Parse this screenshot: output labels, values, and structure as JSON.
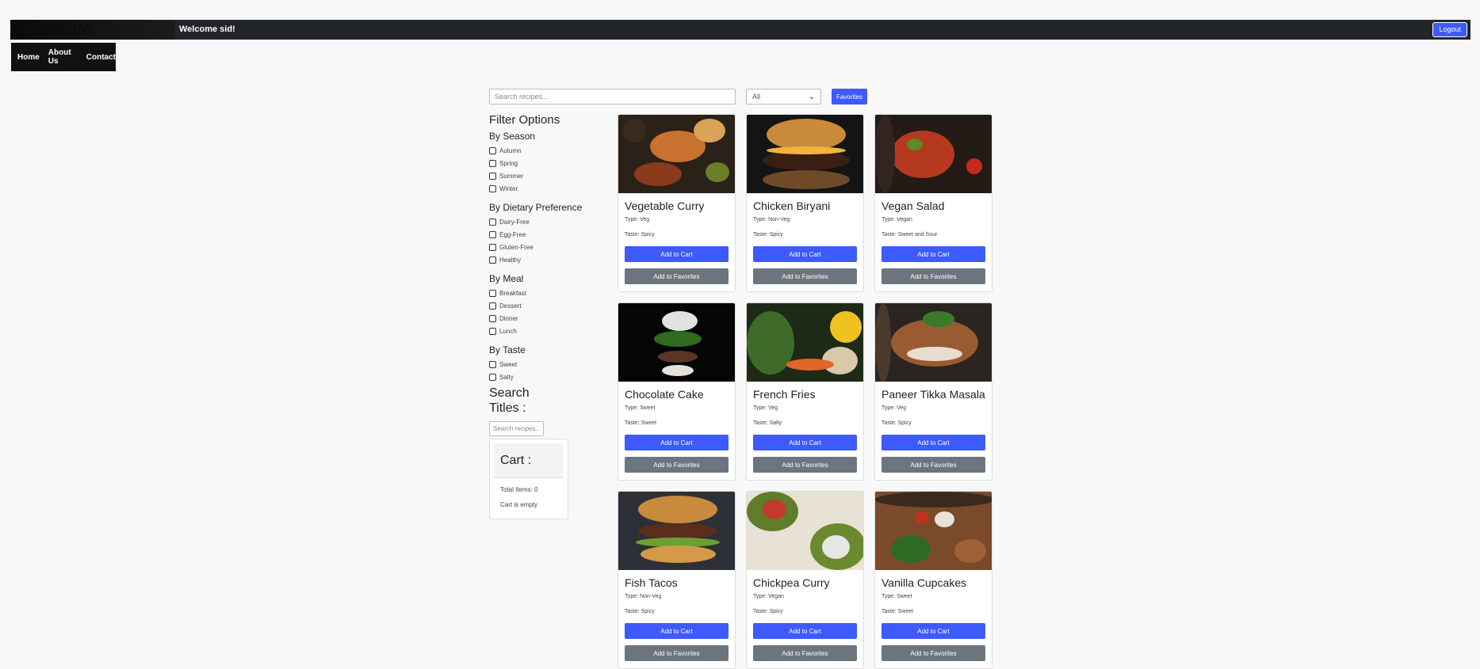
{
  "header": {
    "brand": "OneAssure",
    "welcome": "Welcome sid!",
    "logout_label": "Logout"
  },
  "nav": {
    "home": "Home",
    "about": "About Us",
    "contact": "Contact"
  },
  "search": {
    "placeholder": "Search recipes...",
    "filter_select": "All",
    "favorites_label": "Favorites"
  },
  "sidebar": {
    "title": "Filter Options",
    "groups": [
      {
        "title": "By Season",
        "options": [
          "Autumn",
          "Spring",
          "Summer",
          "Winter"
        ]
      },
      {
        "title": "By Dietary Preference",
        "options": [
          "Dairy-Free",
          "Egg-Free",
          "Gluten-Free",
          "Healthy"
        ]
      },
      {
        "title": "By Meal",
        "options": [
          "Breakfast",
          "Dessert",
          "Dinner",
          "Lunch"
        ]
      },
      {
        "title": "By Taste",
        "options": [
          "Sweet",
          "Salty"
        ]
      }
    ],
    "search_titles_label": "Search Titles :",
    "search_titles_placeholder": "Search recipes..."
  },
  "cart": {
    "title": "Cart :",
    "total_items": "Total Items: 0",
    "empty_message": "Cart is empty"
  },
  "recipes": [
    {
      "name": "Vegetable Curry",
      "type": "Type: Veg",
      "taste": "Taste: Spicy"
    },
    {
      "name": "Chicken Biryani",
      "type": "Type: Non-Veg",
      "taste": "Taste: Spicy"
    },
    {
      "name": "Vegan Salad",
      "type": "Type: Vegan",
      "taste": "Taste: Sweet and Sour"
    },
    {
      "name": "Chocolate Cake",
      "type": "Type: Sweet",
      "taste": "Taste: Sweet"
    },
    {
      "name": "French Fries",
      "type": "Type: Veg",
      "taste": "Taste: Salty"
    },
    {
      "name": "Paneer Tikka Masala",
      "type": "Type: Veg",
      "taste": "Taste: Spicy"
    },
    {
      "name": "Fish Tacos",
      "type": "Type: Non-Veg",
      "taste": "Taste: Spicy"
    },
    {
      "name": "Chickpea Curry",
      "type": "Type: Vegan",
      "taste": "Taste: Spicy"
    },
    {
      "name": "Vanilla Cupcakes",
      "type": "Type: Sweet",
      "taste": "Taste: Sweet"
    }
  ],
  "card_buttons": {
    "add_to_cart": "Add to Cart",
    "add_to_favorites": "Add to Favorites"
  },
  "colors": {
    "primary": "#3d5afe",
    "secondary": "#6c757d",
    "topbar": "#212529"
  }
}
